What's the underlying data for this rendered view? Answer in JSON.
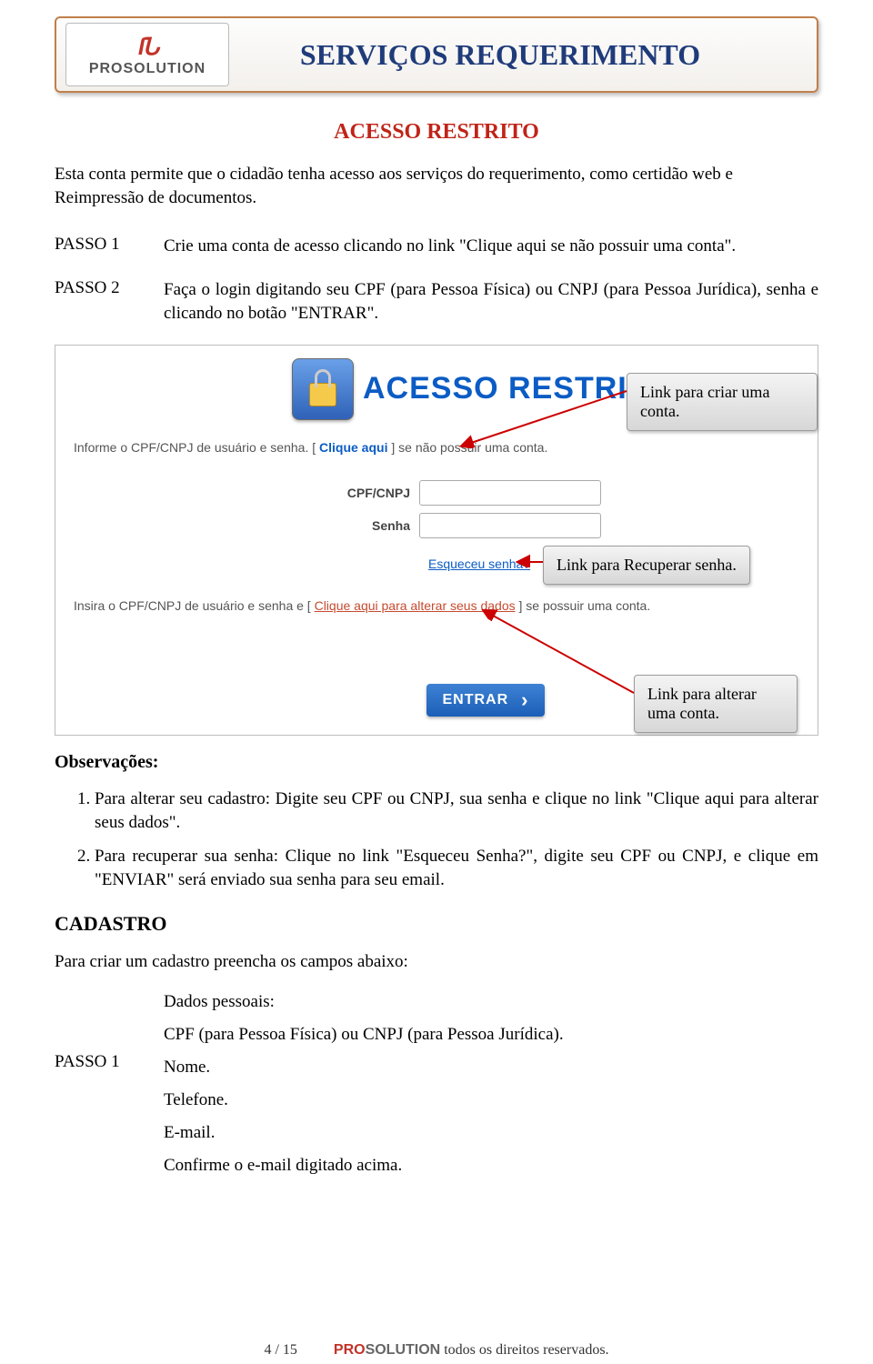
{
  "header": {
    "logo_brand": "PROSOLUTION",
    "title": "SERVIÇOS REQUERIMENTO"
  },
  "section_title": "ACESSO RESTRITO",
  "intro": "Esta conta permite que o cidadão tenha acesso aos serviços do requerimento, como certidão web e Reimpressão de documentos.",
  "steps": {
    "s1_label": "PASSO 1",
    "s1_text": "Crie uma conta de acesso clicando no link \"Clique aqui se não possuir uma conta\".",
    "s2_label": "PASSO 2",
    "s2_text": "Faça o login digitando seu CPF (para Pessoa Física) ou CNPJ (para Pessoa Jurídica), senha e clicando no botão \"ENTRAR\"."
  },
  "screenshot": {
    "title": "ACESSO RESTRITO",
    "line1_a": "Informe o CPF/CNPJ de usuário e senha. [ ",
    "line1_link": "Clique aqui",
    "line1_b": " ] se não possuir uma conta.",
    "cpf_label": "CPF/CNPJ",
    "senha_label": "Senha",
    "forgot": "Esqueceu senha?",
    "line2_a": "Insira o CPF/CNPJ de usuário e senha e [ ",
    "line2_link": "Clique aqui para alterar seus dados",
    "line2_b": " ] se possuir uma conta.",
    "entrar": "ENTRAR"
  },
  "callouts": {
    "c1": "Link para criar uma conta.",
    "c2": "Link para Recuperar senha.",
    "c3": "Link para alterar uma conta."
  },
  "obs_title": "Observações:",
  "obs": {
    "o1": "Para alterar seu cadastro: Digite seu CPF ou CNPJ, sua senha e clique no link \"Clique aqui para alterar seus dados\".",
    "o2": "Para recuperar sua senha: Clique no link \"Esqueceu Senha?\", digite seu CPF ou CNPJ, e clique em \"ENVIAR\" será enviado sua senha para seu email."
  },
  "cadastro_title": "CADASTRO",
  "cadastro_intro": "Para criar um cadastro preencha os campos abaixo:",
  "cadastro": {
    "label": "PASSO 1",
    "l1": "Dados pessoais:",
    "l2": "CPF (para Pessoa Física) ou CNPJ (para Pessoa Jurídica).",
    "l3": "Nome.",
    "l4": "Telefone.",
    "l5": "E-mail.",
    "l6": "Confirme o e-mail digitado acima."
  },
  "footer": {
    "page": "4 / 15",
    "brand_pro": "PRO",
    "brand_sol": "SOLUTION",
    "rights": "  todos os direitos reservados."
  }
}
